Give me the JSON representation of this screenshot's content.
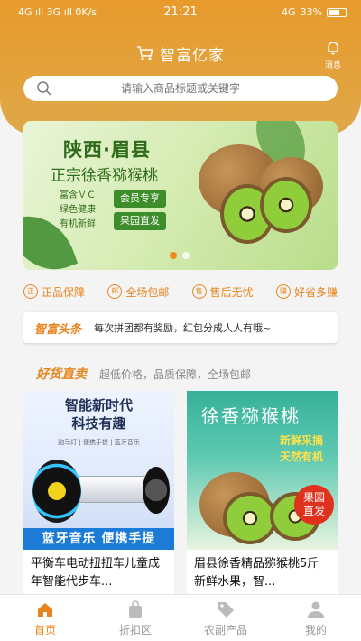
{
  "status_bar": {
    "left": "4G ıll 3G ıll 0K/s",
    "time": "21:21",
    "battery": "33%",
    "network": "4G"
  },
  "header": {
    "title": "智富亿家",
    "message_label": "消息"
  },
  "search": {
    "placeholder": "请输入商品标题或关键字"
  },
  "banner": {
    "title": "陕西·眉县",
    "subtitle": "正宗徐香猕猴桃",
    "features": [
      "富含ＶＣ",
      "绿色健康",
      "有机新鲜"
    ],
    "tags": [
      "会员专享",
      "果园直发"
    ],
    "slide_count": 2,
    "active_slide": 1
  },
  "guarantees": [
    {
      "icon": "正",
      "label": "正品保障"
    },
    {
      "icon": "邮",
      "label": "全场包邮"
    },
    {
      "icon": "售",
      "label": "售后无忧"
    },
    {
      "icon": "赚",
      "label": "好省多赚"
    }
  ],
  "headline": {
    "logo": "智富头条",
    "text": "每次拼团都有奖励，红包分成人人有哦~"
  },
  "section": {
    "title": "好货直卖",
    "subtitle": "超低价格，品质保障，全场包邮"
  },
  "products": [
    {
      "image_title_line1": "智能新时代",
      "image_title_line2": "科技有趣",
      "image_tags": "跑马灯 | 便携手提 | 蓝牙音乐",
      "image_banner": "蓝牙音乐  便携手提",
      "title": "平衡车电动扭扭车儿童成年智能代步车..."
    },
    {
      "image_title": "徐香猕猴桃",
      "image_sub_line1": "新鲜采摘",
      "image_sub_line2": "天然有机",
      "image_badge_line1": "果园",
      "image_badge_line2": "直发",
      "title": "眉县徐香精品猕猴桃5斤 新鲜水果，智..."
    }
  ],
  "tabbar": [
    {
      "label": "首页",
      "icon": "home-icon",
      "active": true
    },
    {
      "label": "折扣区",
      "icon": "bag-icon",
      "active": false
    },
    {
      "label": "农副产品",
      "icon": "tag-icon",
      "active": false
    },
    {
      "label": "我的",
      "icon": "user-icon",
      "active": false
    }
  ],
  "colors": {
    "accent": "#e8841c",
    "header": "#e89a2c"
  }
}
